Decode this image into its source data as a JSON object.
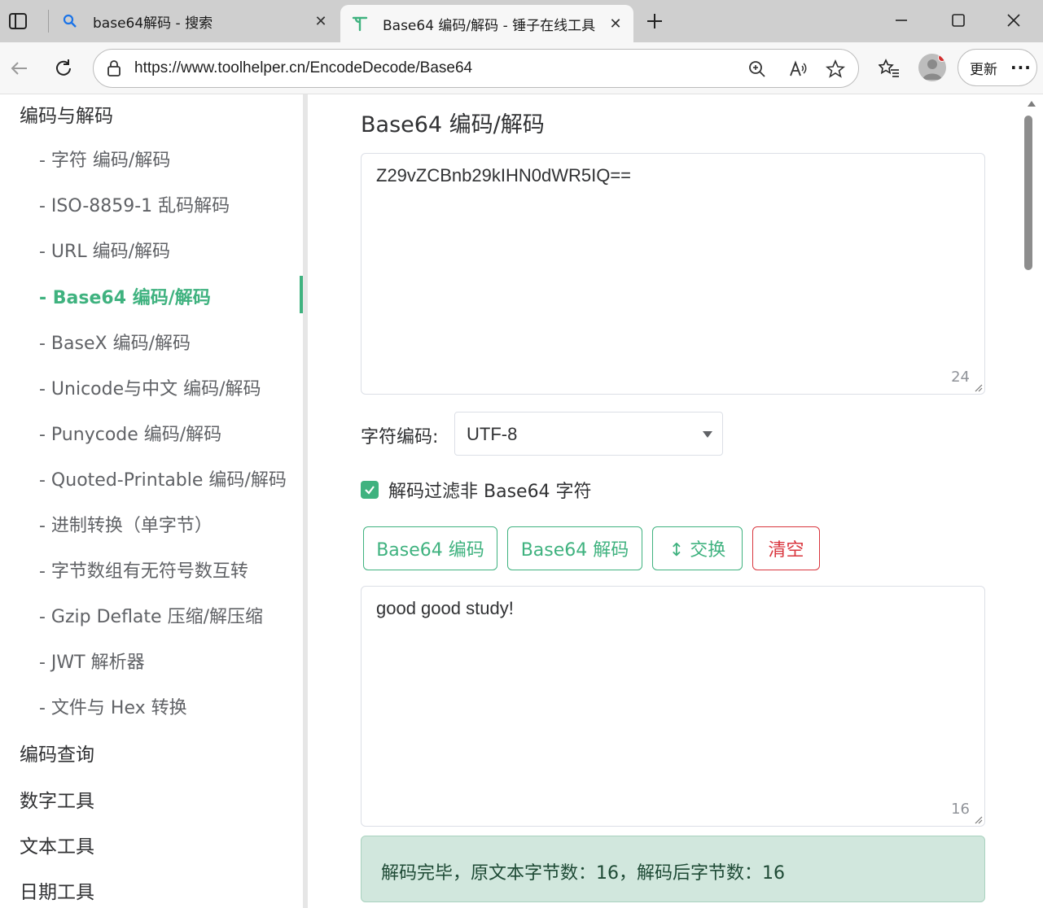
{
  "browser": {
    "tabs": [
      {
        "title": "base64解码 - 搜索",
        "favicon": "search-icon",
        "active": false
      },
      {
        "title": "Base64 编码/解码 - 锤子在线工具",
        "favicon": "toolhelper-logo-icon",
        "active": true
      }
    ],
    "url": "https://www.toolhelper.cn/EncodeDecode/Base64",
    "update_label": "更新",
    "more_label": "···"
  },
  "sidebar": {
    "sections": [
      {
        "label": "编码与解码"
      },
      {
        "label": "编码查询"
      },
      {
        "label": "数字工具"
      },
      {
        "label": "文本工具"
      },
      {
        "label": "日期工具"
      }
    ],
    "items": [
      {
        "label": "- 字符  编码/解码"
      },
      {
        "label": "- ISO-8859-1 乱码解码"
      },
      {
        "label": "- URL  编码/解码"
      },
      {
        "label": "- Base64  编码/解码",
        "active": true
      },
      {
        "label": "- BaseX  编码/解码"
      },
      {
        "label": "- Unicode与中文  编码/解码"
      },
      {
        "label": "- Punycode  编码/解码"
      },
      {
        "label": "- Quoted-Printable  编码/解码"
      },
      {
        "label": "- 进制转换（单字节）"
      },
      {
        "label": "- 字节数组有无符号数互转"
      },
      {
        "label": "- Gzip Deflate 压缩/解压缩"
      },
      {
        "label": "- JWT 解析器"
      },
      {
        "label": "- 文件与 Hex 转换"
      }
    ]
  },
  "main": {
    "title": "Base64 编码/解码",
    "input": {
      "value": "Z29vZCBnb29kIHN0dWR5IQ==",
      "count": "24"
    },
    "encoding": {
      "label": "字符编码:",
      "value": "UTF-8"
    },
    "filter_checkbox": {
      "label": "解码过滤非 Base64 字符",
      "checked": true
    },
    "buttons": {
      "encode": "Base64 编码",
      "decode": "Base64 解码",
      "swap": "↕ 交换",
      "clear": "清空"
    },
    "output": {
      "value": "good good study!",
      "count": "16"
    },
    "status": "解码完毕，原文本字节数：16，解码后字节数：16"
  },
  "colors": {
    "accent": "#3fb27f",
    "danger": "#d9363e",
    "alert_bg": "#d1e7dd"
  }
}
